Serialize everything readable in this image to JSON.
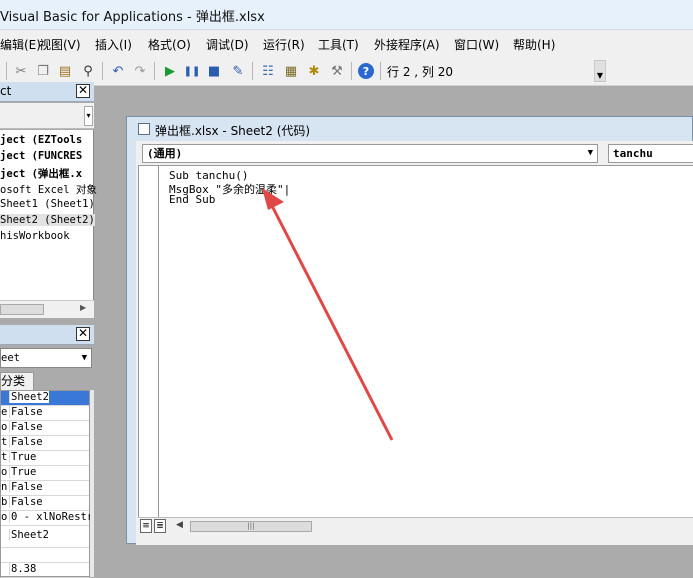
{
  "window": {
    "title": "Visual Basic for Applications - 弹出框.xlsx"
  },
  "menu": [
    "编辑(E)",
    "视图(V)",
    "插入(I)",
    "格式(O)",
    "调试(D)",
    "运行(R)",
    "工具(T)",
    "外接程序(A)",
    "窗口(W)",
    "帮助(H)"
  ],
  "toolbar": {
    "status": "行 2 , 列 20"
  },
  "project": {
    "header": "ct",
    "items": [
      "ject (EZTools",
      "ject (FUNCRES",
      "ject (弹出框.x",
      "osoft Excel 对象",
      "Sheet1 (Sheet1)",
      "Sheet2 (Sheet2)",
      "hisWorkbook"
    ]
  },
  "properties": {
    "object": "eet",
    "tab": "分类序",
    "rows": [
      {
        "k": "",
        "v": "Sheet2"
      },
      {
        "k": "e",
        "v": "False"
      },
      {
        "k": "o",
        "v": "False"
      },
      {
        "k": "t",
        "v": "False"
      },
      {
        "k": "t",
        "v": "True"
      },
      {
        "k": "o",
        "v": "True"
      },
      {
        "k": "n",
        "v": "False"
      },
      {
        "k": "b",
        "v": "False"
      },
      {
        "k": "o",
        "v": "0 - xlNoRestr"
      },
      {
        "k": "",
        "v": "Sheet2"
      },
      {
        "k": "",
        "v": ""
      },
      {
        "k": "",
        "v": "8.38"
      }
    ]
  },
  "codewindow": {
    "title": "弹出框.xlsx - Sheet2 (代码)",
    "object_combo": "(通用)",
    "proc_combo": "tanchu",
    "lines": [
      "Sub tanchu()",
      "MsgBox \"多余的温柔\"|",
      "End Sub"
    ]
  },
  "colors": {
    "arrow": "#e04848",
    "titlebar": "#e6f1fb",
    "selection": "#3a78d8"
  }
}
